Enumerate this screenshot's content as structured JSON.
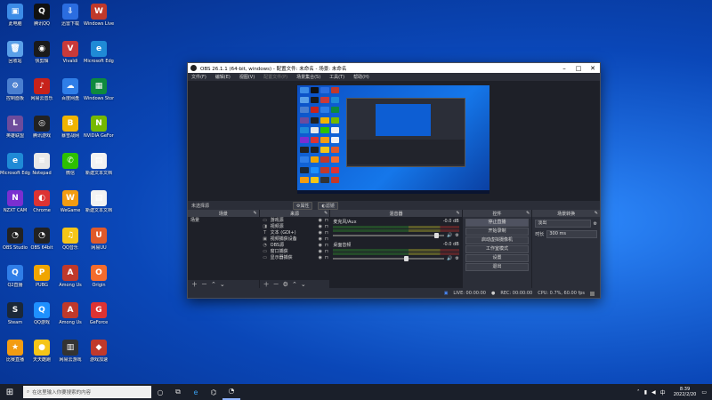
{
  "desktop": {
    "icons": [
      {
        "label": "此电脑",
        "color": "#3c8ce7",
        "glyph": "▣"
      },
      {
        "label": "腾讯QQ",
        "color": "#111111",
        "glyph": "Q"
      },
      {
        "label": "迅雷下载",
        "color": "#2b6de0",
        "glyph": "⇩"
      },
      {
        "label": "Windows Live",
        "color": "#c0392b",
        "glyph": "W"
      },
      {
        "label": "回收站",
        "color": "#5aa0e8",
        "glyph": "🗑"
      },
      {
        "label": "快剪辑",
        "color": "#1a1a1a",
        "glyph": "◉"
      },
      {
        "label": "Vivaldi",
        "color": "#c93a3a",
        "glyph": "V"
      },
      {
        "label": "Microsoft Edge",
        "color": "#1f8ad6",
        "glyph": "e"
      },
      {
        "label": "控制面板",
        "color": "#4a7fd0",
        "glyph": "⚙"
      },
      {
        "label": "网易云音乐",
        "color": "#c7221b",
        "glyph": "♪"
      },
      {
        "label": "百度网盘",
        "color": "#2f7ee8",
        "glyph": "☁"
      },
      {
        "label": "Windows Store",
        "color": "#0e8a3e",
        "glyph": "▦"
      },
      {
        "label": "英雄联盟",
        "color": "#6d4c9c",
        "glyph": "L"
      },
      {
        "label": "腾讯游戏",
        "color": "#222222",
        "glyph": "◎"
      },
      {
        "label": "暴雪战网",
        "color": "#f0b400",
        "glyph": "B"
      },
      {
        "label": "NVIDIA GeForce",
        "color": "#76b900",
        "glyph": "N"
      },
      {
        "label": "Microsoft Edge",
        "color": "#1f8ad6",
        "glyph": "e"
      },
      {
        "label": "Notepad",
        "color": "#e8e8e8",
        "glyph": "≡"
      },
      {
        "label": "微信",
        "color": "#2dc100",
        "glyph": "✆"
      },
      {
        "label": "新建文本文档",
        "color": "#f2f2f2",
        "glyph": "▤"
      },
      {
        "label": "NZXT CAM",
        "color": "#7a2fd0",
        "glyph": "N"
      },
      {
        "label": "Chrome",
        "color": "#d33",
        "glyph": "◐"
      },
      {
        "label": "WeGame",
        "color": "#f39c12",
        "glyph": "W"
      },
      {
        "label": "新建文本文档",
        "color": "#f2f2f2",
        "glyph": "▤"
      },
      {
        "label": "OBS Studio",
        "color": "#222222",
        "glyph": "◔"
      },
      {
        "label": "OBS 64bit",
        "color": "#222222",
        "glyph": "◔"
      },
      {
        "label": "QQ音乐",
        "color": "#f5c518",
        "glyph": "♫"
      },
      {
        "label": "网易UU",
        "color": "#e05a2a",
        "glyph": "U"
      },
      {
        "label": "Q2直播",
        "color": "#2f7ee8",
        "glyph": "Q"
      },
      {
        "label": "PUBG",
        "color": "#f0a500",
        "glyph": "P"
      },
      {
        "label": "Among Us",
        "color": "#c0392b",
        "glyph": "A"
      },
      {
        "label": "Origin",
        "color": "#f56c2d",
        "glyph": "O"
      },
      {
        "label": "Steam",
        "color": "#1b2838",
        "glyph": "S"
      },
      {
        "label": "QQ游戏",
        "color": "#1e90ff",
        "glyph": "Q"
      },
      {
        "label": "Among Us",
        "color": "#c0392b",
        "glyph": "A"
      },
      {
        "label": "GeForce",
        "color": "#d33",
        "glyph": "G"
      },
      {
        "label": "比赛直播",
        "color": "#f39c12",
        "glyph": "★"
      },
      {
        "label": "天天酷跑",
        "color": "#f5c518",
        "glyph": "●"
      },
      {
        "label": "网易云游戏",
        "color": "#333333",
        "glyph": "▥"
      },
      {
        "label": "游戏加速",
        "color": "#c0392b",
        "glyph": "◆"
      }
    ]
  },
  "obs": {
    "title": "OBS 26.1.1 (64-bit, windows) - 配置文件: 未命名 - 场景: 未命名",
    "menu": [
      "文件(F)",
      "编辑(E)",
      "视图(V)",
      "配置文件(P)",
      "场景集合(S)",
      "工具(T)",
      "帮助(H)"
    ],
    "scene_bar": {
      "name": "未选择源",
      "props": "⚙属性",
      "filters": "◐滤镜"
    },
    "docks": {
      "scenes": {
        "title": "场景",
        "items": [
          "场景"
        ]
      },
      "sources": {
        "title": "来源",
        "items": [
          {
            "icon": "▭",
            "name": "游戏源"
          },
          {
            "icon": "◨",
            "name": "视频源"
          },
          {
            "icon": "T",
            "name": "文本 (GDI+)"
          },
          {
            "icon": "▣",
            "name": "视频捕获设备"
          },
          {
            "icon": "◔",
            "name": "OBS源"
          },
          {
            "icon": "▭",
            "name": "窗口捕获"
          },
          {
            "icon": "▭",
            "name": "显示器捕获"
          }
        ]
      },
      "mixer": {
        "title": "混音器",
        "channels": [
          {
            "name": "麦克风/Aux",
            "db": "-0.0 dB"
          },
          {
            "name": "桌面音频",
            "db": "-0.0 dB"
          }
        ]
      },
      "controls": {
        "title": "控件",
        "buttons": [
          "停止直播",
          "开始录制",
          "启动虚拟摄像机",
          "工作室模式",
          "设置",
          "退出"
        ]
      },
      "transitions": {
        "title": "场景转换",
        "type": "淡出",
        "duration_label": "时长",
        "duration": "300 ms"
      }
    },
    "status": {
      "live": "LIVE: 00:00:00",
      "rec": "REC: 00:00:00",
      "cpu": "CPU: 0.7%, 60.00 fps"
    }
  },
  "taskbar": {
    "search_placeholder": "在这里输入你要搜索的内容",
    "time": "8:39",
    "date": "2022/2/20"
  }
}
